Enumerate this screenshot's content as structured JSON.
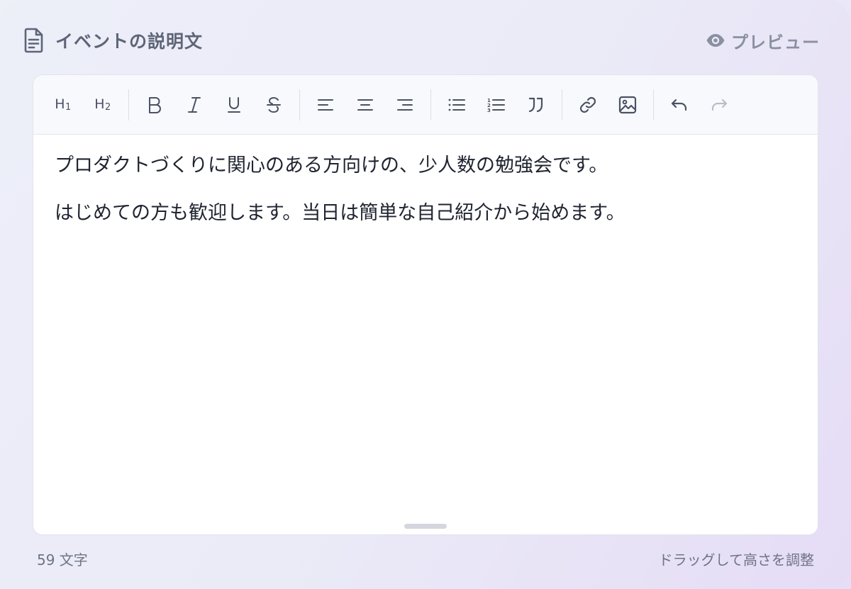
{
  "header": {
    "title": "イベントの説明文",
    "title_icon": "document-icon",
    "preview_label": "プレビュー",
    "preview_icon": "eye-icon"
  },
  "toolbar": {
    "groups": [
      [
        {
          "name": "heading-1",
          "icon": "h1-icon",
          "label": "H",
          "sub": "1"
        },
        {
          "name": "heading-2",
          "icon": "h2-icon",
          "label": "H",
          "sub": "2"
        }
      ],
      [
        {
          "name": "bold",
          "icon": "bold-icon"
        },
        {
          "name": "italic",
          "icon": "italic-icon"
        },
        {
          "name": "underline",
          "icon": "underline-icon"
        },
        {
          "name": "strikethrough",
          "icon": "strikethrough-icon"
        }
      ],
      [
        {
          "name": "align-left",
          "icon": "align-left-icon"
        },
        {
          "name": "align-center",
          "icon": "align-center-icon"
        },
        {
          "name": "align-right",
          "icon": "align-right-icon"
        }
      ],
      [
        {
          "name": "bullet-list",
          "icon": "bullet-list-icon"
        },
        {
          "name": "numbered-list",
          "icon": "numbered-list-icon"
        },
        {
          "name": "blockquote",
          "icon": "quote-icon"
        }
      ],
      [
        {
          "name": "link",
          "icon": "link-icon"
        },
        {
          "name": "image",
          "icon": "image-icon"
        }
      ],
      [
        {
          "name": "undo",
          "icon": "undo-icon",
          "enabled": true
        },
        {
          "name": "redo",
          "icon": "redo-icon",
          "enabled": false
        }
      ]
    ]
  },
  "content": {
    "paragraphs": [
      "プロダクトづくりに関心のある方向けの、少人数の勉強会です。",
      "はじめての方も歓迎します。当日は簡単な自己紹介から始めます。"
    ]
  },
  "footer": {
    "char_count": "59 文字",
    "resize_hint": "ドラッグして高さを調整"
  },
  "colors": {
    "icon": "#4b5263",
    "icon_disabled": "#b9bdc8",
    "title": "#5e6577",
    "text": "#1f2430"
  }
}
